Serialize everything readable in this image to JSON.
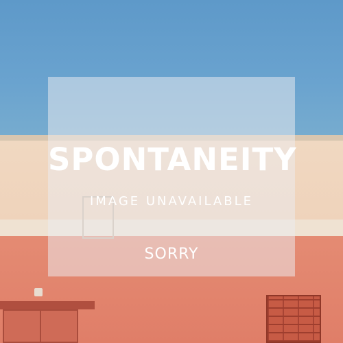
{
  "placeholder": {
    "title": "SPONTANEITY",
    "subtitle": "IMAGE UNAVAILABLE",
    "message": "SORRY"
  },
  "colors": {
    "sky": "#6aa3cf",
    "wall_upper": "#f0d8c1",
    "wall_lower": "#e07e68",
    "overlay": "rgba(235,235,240,0.52)",
    "text": "#ffffff"
  }
}
